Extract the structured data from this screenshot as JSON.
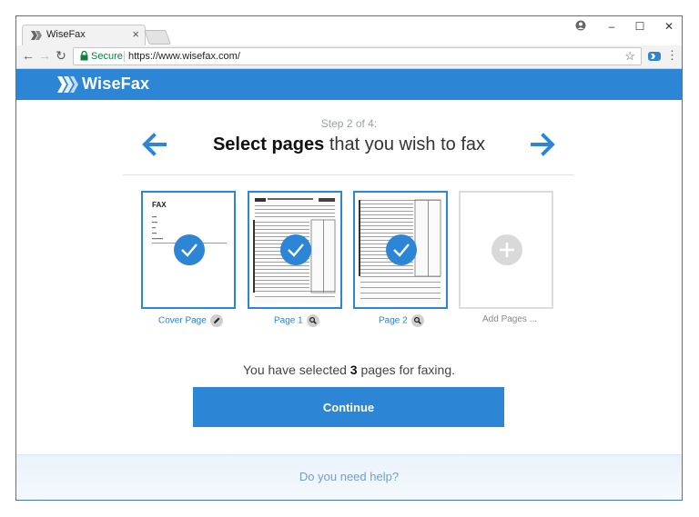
{
  "browser": {
    "tab_title": "WiseFax",
    "tab_close": "×",
    "secure_label": "Secure",
    "url": "https://www.wisefax.com/",
    "window_controls": {
      "profile": "profile-icon",
      "minimize": "–",
      "maximize": "☐",
      "close": "✕"
    }
  },
  "site": {
    "logo_text": "WiseFax",
    "brand_color": "#2d86d5"
  },
  "wizard": {
    "step_label": "Step 2 of 4:",
    "title_bold": "Select pages",
    "title_rest": " that you wish to fax"
  },
  "pages": [
    {
      "caption": "Cover Page",
      "icon": "pencil-icon",
      "selected": true,
      "doc_heading": "FAX"
    },
    {
      "caption": "Page 1",
      "icon": "magnifier-icon",
      "selected": true
    },
    {
      "caption": "Page 2",
      "icon": "magnifier-icon",
      "selected": true
    },
    {
      "caption": "Add Pages ...",
      "icon": "plus-icon",
      "selected": false
    }
  ],
  "summary": {
    "prefix": "You have selected ",
    "count": "3",
    "suffix": " pages for faxing."
  },
  "continue_label": "Continue",
  "help_link": "Do you need help?"
}
